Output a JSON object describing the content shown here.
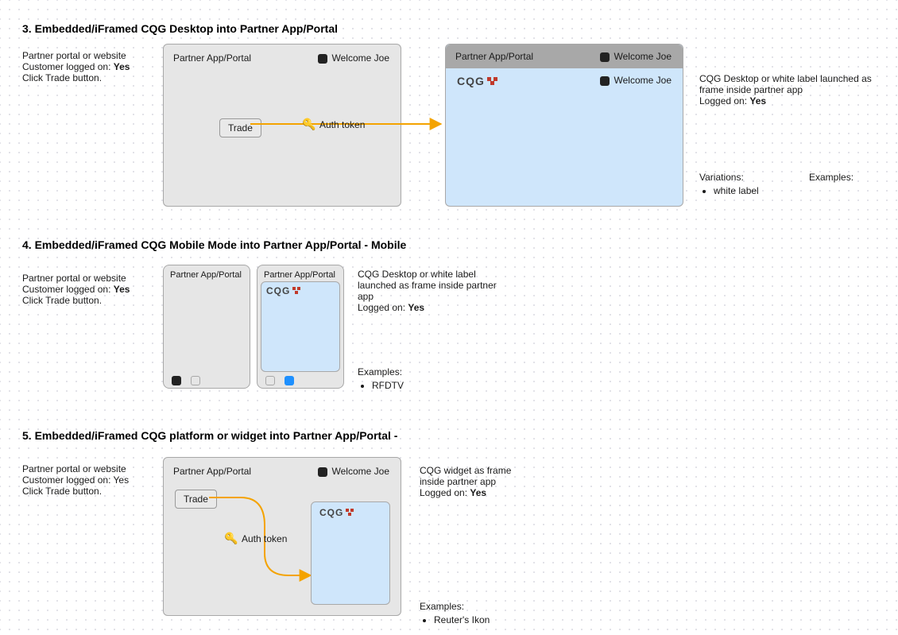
{
  "section3": {
    "heading": "3. Embedded/iFramed CQG Desktop into Partner App/Portal",
    "left_col": {
      "l1": "Partner portal or website",
      "l2a": "Customer logged on: ",
      "l2b": "Yes",
      "l3": "Click Trade button."
    },
    "panel_left": {
      "title": "Partner App/Portal",
      "welcome": "Welcome Joe",
      "trade": "Trade",
      "auth": "Auth token"
    },
    "panel_right": {
      "title": "Partner App/Portal",
      "welcome": "Welcome Joe",
      "inner_welcome": "Welcome Joe",
      "cqg": "CQG"
    },
    "right_col": {
      "p1": "CQG Desktop or white label launched as frame inside partner app",
      "p2a": "Logged on: ",
      "p2b": "Yes",
      "variations_label": "Variations:",
      "variation_item": "white label",
      "examples_label": "Examples:"
    }
  },
  "section4": {
    "heading": "4. Embedded/iFramed CQG Mobile Mode into Partner App/Portal - Mobile",
    "left_col": {
      "l1": "Partner portal or website",
      "l2a": "Customer logged on: ",
      "l2b": "Yes",
      "l3": "Click Trade button."
    },
    "mobile_left": {
      "title": "Partner App/Portal"
    },
    "mobile_right": {
      "title": "Partner App/Portal",
      "cqg": "CQG"
    },
    "right_col": {
      "p1": "CQG Desktop or white label launched as frame inside partner app",
      "p2a": "Logged on: ",
      "p2b": "Yes",
      "examples_label": "Examples:",
      "example_item": "RFDTV"
    }
  },
  "section5": {
    "heading": "5. Embedded/iFramed CQG platform or widget into Partner App/Portal -",
    "left_col": {
      "l1": "Partner portal or website",
      "l2": "Customer logged on: Yes",
      "l3": "Click Trade button."
    },
    "panel": {
      "title": "Partner App/Portal",
      "welcome": "Welcome Joe",
      "trade": "Trade",
      "auth": "Auth token",
      "cqg": "CQG"
    },
    "right_col": {
      "p1": "CQG widget as frame inside partner app",
      "p2a": "Logged on: ",
      "p2b": "Yes",
      "examples_label": "Examples:",
      "example_item": "Reuter's Ikon"
    }
  }
}
